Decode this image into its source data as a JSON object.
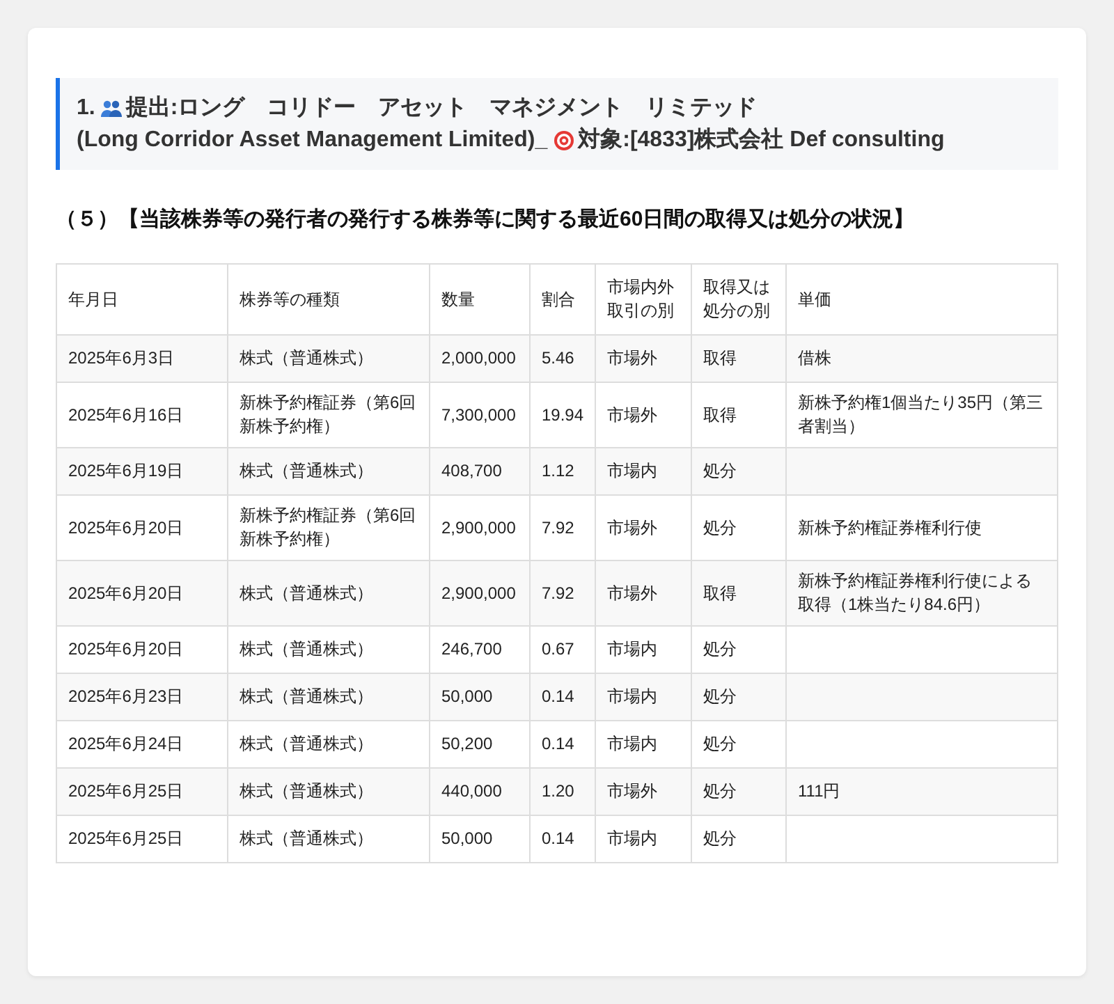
{
  "header": {
    "number": "1.",
    "filer": "提出:ロング　コリドー　アセット　マネジメント　リミテッド",
    "filer_en": "(Long Corridor Asset Management Limited)_",
    "target": "対象:[4833]株式会社 Def consulting"
  },
  "section_title": "（５）【当該株券等の発行者の発行する株券等に関する最近60日間の取得又は処分の状況】",
  "table": {
    "columns": [
      "年月日",
      "株券等の種類",
      "数量",
      "割合",
      "市場内外取引の別",
      "取得又は処分の別",
      "単価"
    ],
    "rows": [
      [
        "2025年6月3日",
        "株式（普通株式）",
        "2,000,000",
        "5.46",
        "市場外",
        "取得",
        "借株"
      ],
      [
        "2025年6月16日",
        "新株予約権証券（第6回新株予約権）",
        "7,300,000",
        "19.94",
        "市場外",
        "取得",
        "新株予約権1個当たり35円（第三者割当）"
      ],
      [
        "2025年6月19日",
        "株式（普通株式）",
        "408,700",
        "1.12",
        "市場内",
        "処分",
        ""
      ],
      [
        "2025年6月20日",
        "新株予約権証券（第6回新株予約権）",
        "2,900,000",
        "7.92",
        "市場外",
        "処分",
        "新株予約権証券権利行使"
      ],
      [
        "2025年6月20日",
        "株式（普通株式）",
        "2,900,000",
        "7.92",
        "市場外",
        "取得",
        "新株予約権証券権利行使による取得（1株当たり84.6円）"
      ],
      [
        "2025年6月20日",
        "株式（普通株式）",
        "246,700",
        "0.67",
        "市場内",
        "処分",
        ""
      ],
      [
        "2025年6月23日",
        "株式（普通株式）",
        "50,000",
        "0.14",
        "市場内",
        "処分",
        ""
      ],
      [
        "2025年6月24日",
        "株式（普通株式）",
        "50,200",
        "0.14",
        "市場内",
        "処分",
        ""
      ],
      [
        "2025年6月25日",
        "株式（普通株式）",
        "440,000",
        "1.20",
        "市場外",
        "処分",
        "111円"
      ],
      [
        "2025年6月25日",
        "株式（普通株式）",
        "50,000",
        "0.14",
        "市場内",
        "処分",
        ""
      ]
    ]
  }
}
